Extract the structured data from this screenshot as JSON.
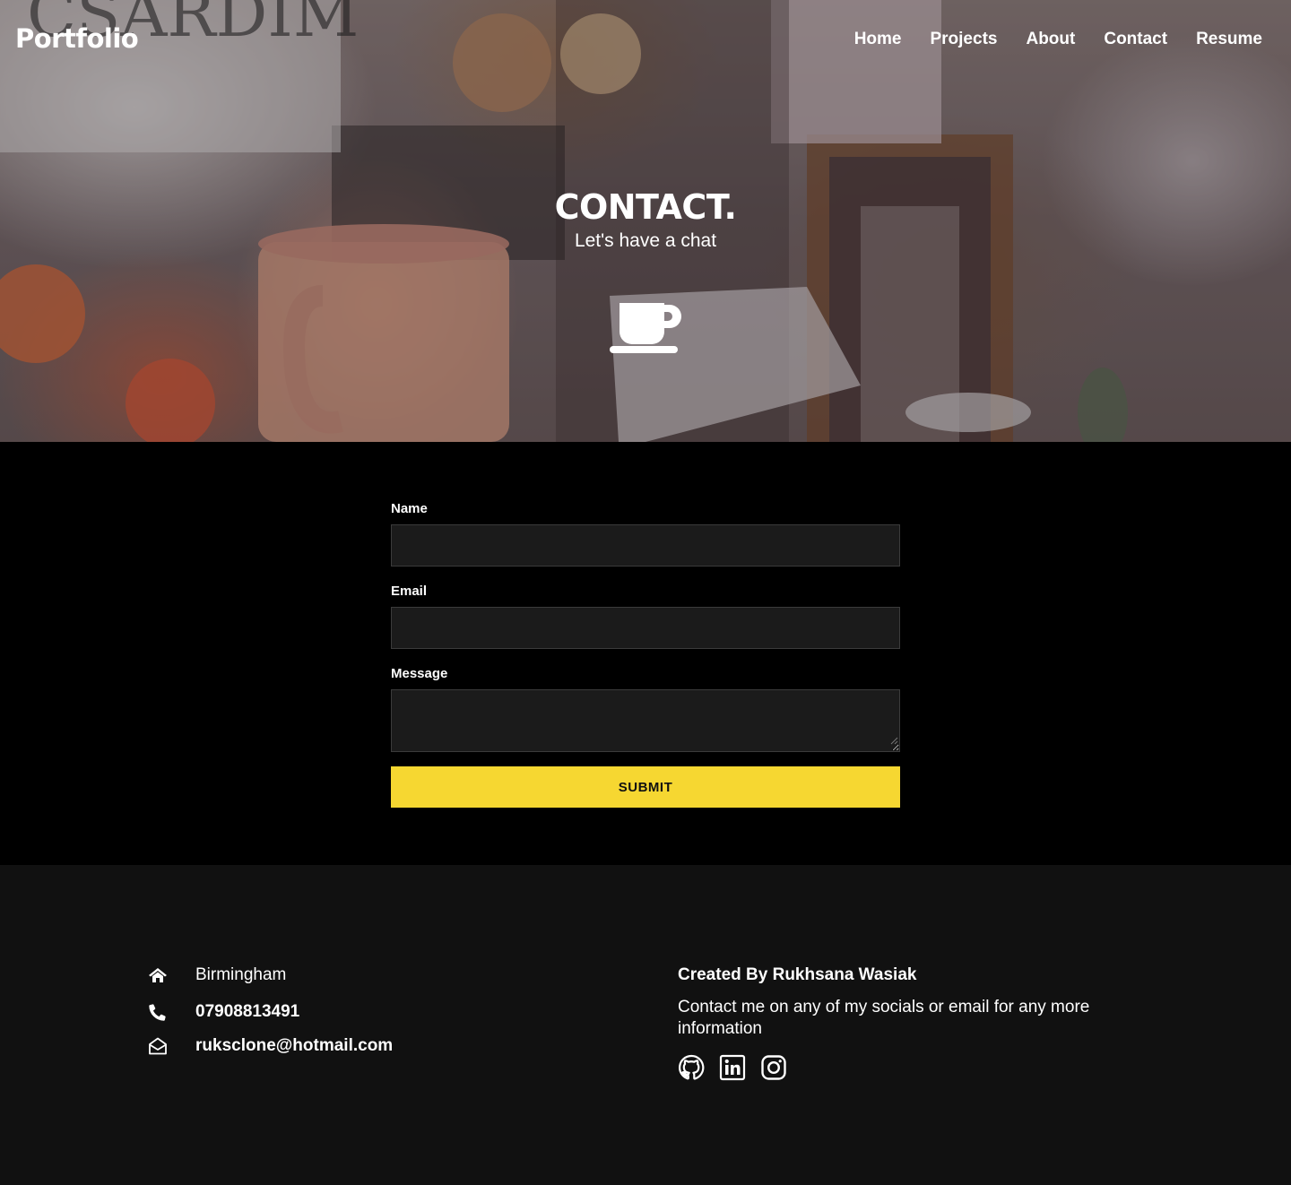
{
  "header": {
    "brand": "Portfolio",
    "nav": [
      "Home",
      "Projects",
      "About",
      "Contact",
      "Resume"
    ]
  },
  "hero": {
    "title": "CONTACT.",
    "subtitle": "Let's have a chat",
    "icon": "coffee-cup-icon"
  },
  "form": {
    "name_label": "Name",
    "email_label": "Email",
    "message_label": "Message",
    "name_value": "",
    "email_value": "",
    "message_value": "",
    "submit_label": "SUBMIT",
    "submit_color": "#f6d731"
  },
  "footer": {
    "location": "Birmingham",
    "phone": "07908813491",
    "email": "ruksclone@hotmail.com",
    "credit": "Created By Rukhsana Wasiak",
    "blurb": "Contact me on any of my socials or email for any more information",
    "icons": [
      "home-icon",
      "phone-icon",
      "envelope-open-icon"
    ],
    "socials": [
      "github-icon",
      "linkedin-icon",
      "instagram-icon"
    ]
  }
}
